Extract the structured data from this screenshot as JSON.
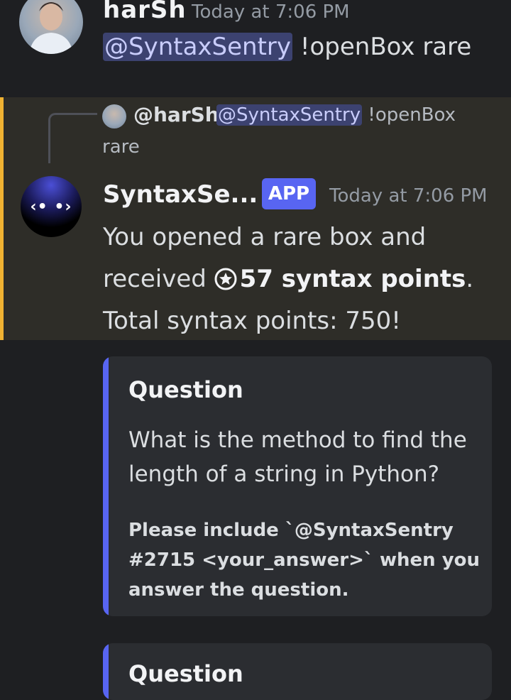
{
  "message1": {
    "username": "harSh",
    "timestamp": "Today at 7:06 PM",
    "mention": "@SyntaxSentry",
    "command": " !openBox rare"
  },
  "message2": {
    "reply": {
      "username": "@harSh",
      "mention": "@SyntaxSentry",
      "text": " !openBox",
      "text_cont": "rare"
    },
    "bot_name": "SyntaxSe...",
    "badge": "APP",
    "timestamp": "Today at 7:06 PM",
    "content_line1": "You opened a rare box and",
    "content_line2_prefix": "received ",
    "points_bold": "57 syntax points",
    "content_line2_suffix": ".",
    "content_line3": "Total syntax points: 750!"
  },
  "embed": {
    "title": "Question",
    "description": "What is the method to find the length of a string in Python?",
    "footer": "Please include `@SyntaxSentry #2715 <your_answer>` when you answer the question."
  },
  "embed2": {
    "title": "Question"
  },
  "colors": {
    "background": "#1e1f22",
    "highlight_bg": "#2e2d28",
    "highlight_bar": "#f0b232",
    "accent": "#5865f2",
    "mention_bg": "#3c4270"
  }
}
